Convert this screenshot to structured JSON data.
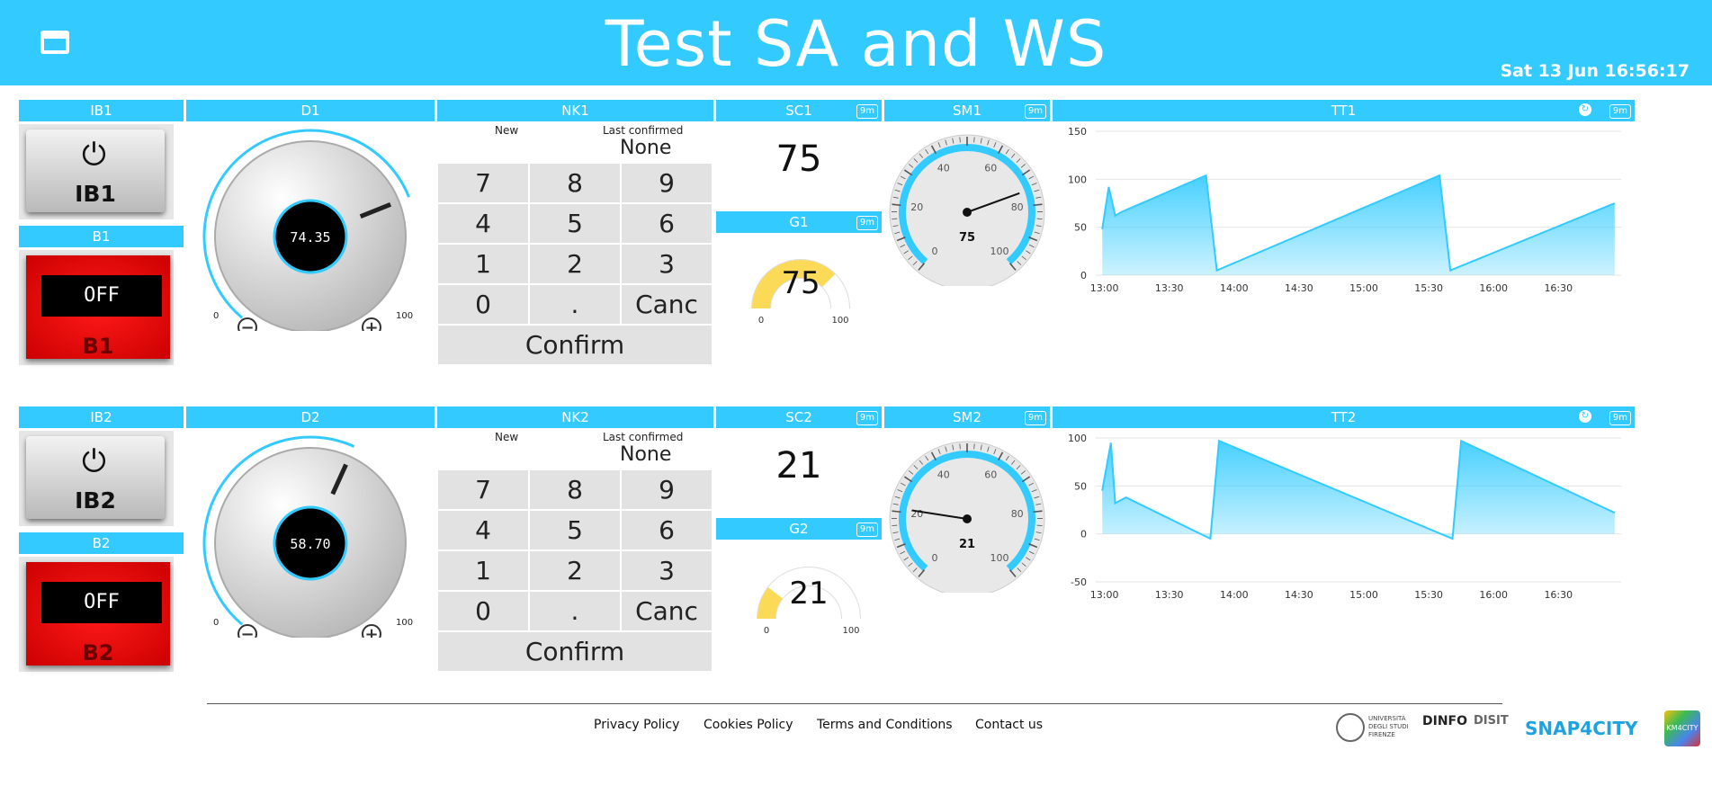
{
  "header": {
    "title": "Test SA and WS",
    "clock": "Sat 13 Jun 16:56:17",
    "background": "#33cbff"
  },
  "badge": "9m",
  "rows": [
    {
      "ib": {
        "title": "IB1",
        "label": "IB1"
      },
      "b": {
        "title": "B1",
        "display": "OFF",
        "label": "B1"
      },
      "d": {
        "title": "D1",
        "value": "74.35",
        "min": "0",
        "max": "100"
      },
      "nk": {
        "title": "NK1",
        "new_label": "New",
        "last_label": "Last confirmed",
        "last_value": "None"
      },
      "sc": {
        "title": "SC1",
        "value": "75"
      },
      "g": {
        "title": "G1",
        "value": "75",
        "min": "0",
        "max": "100",
        "level": 0.75
      },
      "sm": {
        "title": "SM1",
        "value": "75"
      },
      "tt": {
        "title": "TT1"
      }
    },
    {
      "ib": {
        "title": "IB2",
        "label": "IB2"
      },
      "b": {
        "title": "B2",
        "display": "OFF",
        "label": "B2"
      },
      "d": {
        "title": "D2",
        "value": "58.70",
        "min": "0",
        "max": "100"
      },
      "nk": {
        "title": "NK2",
        "new_label": "New",
        "last_label": "Last confirmed",
        "last_value": "None"
      },
      "sc": {
        "title": "SC2",
        "value": "21"
      },
      "g": {
        "title": "G2",
        "value": "21",
        "min": "0",
        "max": "100",
        "level": 0.21
      },
      "sm": {
        "title": "SM2",
        "value": "21"
      },
      "tt": {
        "title": "TT2"
      }
    }
  ],
  "keypad": {
    "keys": [
      "7",
      "8",
      "9",
      "4",
      "5",
      "6",
      "1",
      "2",
      "3",
      "0",
      ".",
      "Canc"
    ],
    "confirm": "Confirm"
  },
  "speedometer_ticks": [
    "0",
    "20",
    "40",
    "60",
    "80",
    "100"
  ],
  "chart_data": [
    {
      "type": "area",
      "title": "TT1",
      "x_ticks": [
        "13:00",
        "13:30",
        "14:00",
        "14:30",
        "15:00",
        "15:30",
        "16:00",
        "16:30"
      ],
      "y_ticks": [
        "0",
        "50",
        "100",
        "150"
      ],
      "ylim": [
        0,
        150
      ],
      "x": [
        "12:59",
        "13:02",
        "13:05",
        "13:08",
        "13:47",
        "13:52",
        "15:35",
        "15:40",
        "16:56"
      ],
      "values": [
        48,
        92,
        62,
        66,
        104,
        5,
        104,
        5,
        75
      ]
    },
    {
      "type": "area",
      "title": "TT2",
      "x_ticks": [
        "13:00",
        "13:30",
        "14:00",
        "14:30",
        "15:00",
        "15:30",
        "16:00",
        "16:30"
      ],
      "y_ticks": [
        "-50",
        "0",
        "50",
        "100"
      ],
      "ylim": [
        -50,
        100
      ],
      "x": [
        "12:59",
        "13:03",
        "13:05",
        "13:10",
        "13:49",
        "13:53",
        "15:41",
        "15:45",
        "16:56"
      ],
      "values": [
        45,
        95,
        32,
        38,
        -5,
        97,
        -5,
        97,
        22
      ]
    }
  ],
  "footer": {
    "links": [
      "Privacy Policy",
      "Cookies Policy",
      "Terms and Conditions",
      "Contact us"
    ],
    "logos": [
      "UNIVERSITÀ DEGLI STUDI FIRENZE",
      "DINFO",
      "DISIT",
      "SNAP4CITY",
      "KM4CITY"
    ]
  }
}
